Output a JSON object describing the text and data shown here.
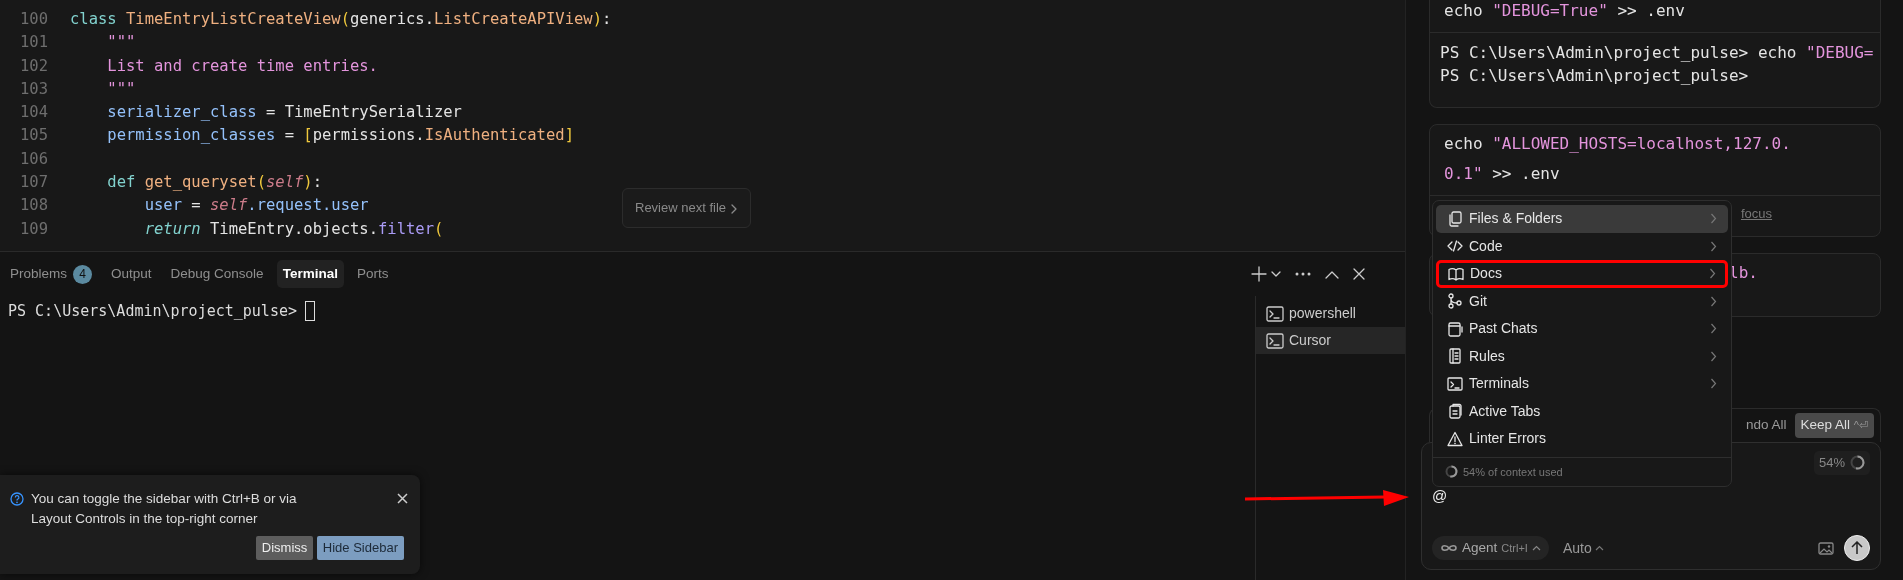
{
  "editor": {
    "lines": [
      {
        "number": "100",
        "tokens": [
          {
            "text": "class ",
            "kind": "keyword"
          },
          {
            "text": "TimeEntryListCreateView",
            "kind": "type"
          },
          {
            "text": "(",
            "kind": "bracket"
          },
          {
            "text": "generics.",
            "kind": "plain"
          },
          {
            "text": "ListCreateAPIView",
            "kind": "type"
          },
          {
            "text": ")",
            "kind": "bracket"
          },
          {
            "text": ":",
            "kind": "plain"
          }
        ]
      },
      {
        "number": "101",
        "tokens": [
          {
            "text": "    \"\"\"",
            "kind": "string"
          }
        ]
      },
      {
        "number": "102",
        "tokens": [
          {
            "text": "    List and create time entries.",
            "kind": "string"
          }
        ]
      },
      {
        "number": "103",
        "tokens": [
          {
            "text": "    \"\"\"",
            "kind": "string"
          }
        ]
      },
      {
        "number": "104",
        "tokens": [
          {
            "text": "    serializer_class",
            "kind": "variable"
          },
          {
            "text": " = ",
            "kind": "plain"
          },
          {
            "text": "TimeEntrySerializer",
            "kind": "plain"
          }
        ]
      },
      {
        "number": "105",
        "tokens": [
          {
            "text": "    permission_classes",
            "kind": "variable"
          },
          {
            "text": " = ",
            "kind": "plain"
          },
          {
            "text": "[",
            "kind": "bracket"
          },
          {
            "text": "permissions.",
            "kind": "plain"
          },
          {
            "text": "IsAuthenticated",
            "kind": "type"
          },
          {
            "text": "]",
            "kind": "bracket"
          }
        ]
      },
      {
        "number": "106"
      },
      {
        "number": "107",
        "tokens": [
          {
            "text": "    def ",
            "kind": "keyword"
          },
          {
            "text": "get_queryset",
            "kind": "type"
          },
          {
            "text": "(",
            "kind": "bracket"
          },
          {
            "text": "self",
            "kind": "self"
          },
          {
            "text": ")",
            "kind": "bracket"
          },
          {
            "text": ":",
            "kind": "plain"
          }
        ]
      },
      {
        "number": "108",
        "tokens": [
          {
            "text": "        user",
            "kind": "variable"
          },
          {
            "text": " = ",
            "kind": "plain"
          },
          {
            "text": "self",
            "kind": "self"
          },
          {
            "text": ".request.user",
            "kind": "variable"
          }
        ]
      },
      {
        "number": "109",
        "tokens": [
          {
            "text": "        return",
            "kind": "control"
          },
          {
            "text": " TimeEntry.objects.",
            "kind": "plain"
          },
          {
            "text": "filter",
            "kind": "method"
          },
          {
            "text": "(",
            "kind": "bracket"
          }
        ]
      }
    ],
    "review_button": "Review next file"
  },
  "panel": {
    "tabs": [
      {
        "label": "Problems",
        "badge": "4",
        "selected": false
      },
      {
        "label": "Output",
        "selected": false
      },
      {
        "label": "Debug Console",
        "selected": false
      },
      {
        "label": "Terminal",
        "selected": true
      },
      {
        "label": "Ports",
        "selected": false
      }
    ],
    "terminal_prompt": "PS C:\\Users\\Admin\\project_pulse>",
    "terminals": [
      {
        "label": "powershell",
        "selected": false
      },
      {
        "label": "Cursor",
        "selected": true
      }
    ]
  },
  "notification": {
    "text": "You can toggle the sidebar with Ctrl+B or via Layout Controls in the top-right corner",
    "buttons": [
      {
        "label": "Dismiss",
        "kind": "secondary"
      },
      {
        "label": "Hide Sidebar",
        "kind": "primary"
      }
    ]
  },
  "chat": {
    "cards": [
      {
        "command": [
          {
            "text": "echo ",
            "kind": "plain"
          },
          {
            "text": "\"DEBUG=True\"",
            "kind": "string"
          },
          {
            "text": " >> .env",
            "kind": "plain"
          }
        ],
        "output": [
          [
            {
              "text": "PS C:\\Users\\Admin\\project_pulse> echo ",
              "kind": "plain"
            },
            {
              "text": "\"DEBUG=",
              "kind": "string"
            }
          ],
          [
            {
              "text": "PS C:\\Users\\Admin\\project_pulse>",
              "kind": "plain"
            }
          ]
        ]
      },
      {
        "command": [
          {
            "text": "echo ",
            "kind": "plain"
          },
          {
            "text": "\"ALLOWED_HOSTS=localhost,127.0.0.1\"",
            "kind": "string"
          },
          {
            "text": " >> .env",
            "kind": "plain"
          }
        ],
        "footer_link": "focus"
      },
      {
        "command": [
          {
            "text": "lb.",
            "kind": "string"
          }
        ]
      }
    ],
    "undo_label": "ndo All",
    "keep_button": {
      "label": "Keep All",
      "shortcut": "^⏎"
    },
    "context": {
      "label": "54%"
    },
    "input": {
      "value": "@",
      "pointer_arrow": true
    },
    "mode": {
      "label": "Agent",
      "shortcut": "Ctrl+I"
    },
    "model": "Auto"
  },
  "mention_menu": {
    "items": [
      {
        "kind": "files",
        "label": "Files & Folders",
        "submenu": true,
        "selected": true,
        "highlighted": false
      },
      {
        "kind": "code",
        "label": "Code",
        "submenu": true,
        "selected": false,
        "highlighted": false
      },
      {
        "kind": "docs",
        "label": "Docs",
        "submenu": true,
        "selected": false,
        "highlighted": true
      },
      {
        "kind": "git",
        "label": "Git",
        "submenu": true,
        "selected": false,
        "highlighted": false
      },
      {
        "kind": "chats",
        "label": "Past Chats",
        "submenu": true,
        "selected": false,
        "highlighted": false
      },
      {
        "kind": "rules",
        "label": "Rules",
        "submenu": true,
        "selected": false,
        "highlighted": false
      },
      {
        "kind": "terminal",
        "label": "Terminals",
        "submenu": true,
        "selected": false,
        "highlighted": false
      },
      {
        "kind": "tabs",
        "label": "Active Tabs",
        "submenu": false,
        "selected": false,
        "highlighted": false
      },
      {
        "kind": "warning",
        "label": "Linter Errors",
        "submenu": false,
        "selected": false,
        "highlighted": false
      }
    ],
    "footer": {
      "label": "54% of context used"
    }
  }
}
